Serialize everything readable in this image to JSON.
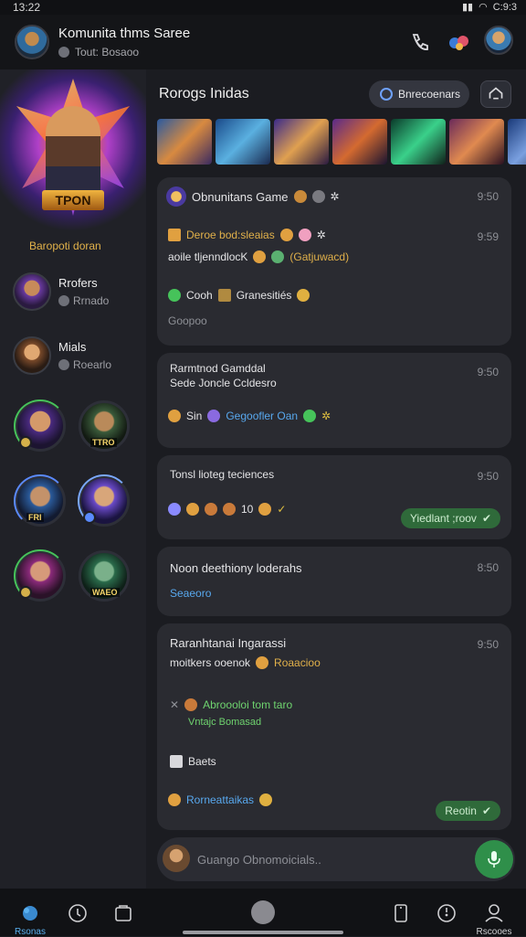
{
  "status": {
    "time": "13:22",
    "battery": "C:9:3"
  },
  "header": {
    "title": "Komunita thms Saree",
    "subtitle": "Tout: Bosaoo"
  },
  "sidebar": {
    "hero_badge": "TPON",
    "hero_caption": "Baropoti doran",
    "items": [
      {
        "name": "Rrofers",
        "meta": "Rrnado"
      },
      {
        "name": "Mials",
        "meta": "Roearlo"
      }
    ],
    "avatar_tags": [
      "TTRO",
      "FRI",
      "WAEO"
    ]
  },
  "main": {
    "section_title": "Rorogs Inidas",
    "browse_label": "Bnrecoenars"
  },
  "cards": [
    {
      "title": "Obnunitans Game",
      "time": "9:50",
      "line2": "Deroe bod:sleaias",
      "line2_time": "9:59",
      "line3a": "aoile tljenndlocK",
      "line3b": "(Gatjuwacd)",
      "line4a": "Cooh",
      "line4b": "Granesitiés",
      "footer": "Goopoo"
    },
    {
      "title": "Rarmtnod Gamddal",
      "time": "9:50",
      "line2": "Sede Joncle Ccldesro",
      "line3a": "Sin",
      "line3b": "Gegoofler Oan"
    },
    {
      "title": "Tonsl lioteg teciences",
      "time": "9:50",
      "line2": "10",
      "pill": "Yiedlant ;roov"
    },
    {
      "title": "Noon deethiony loderahs",
      "time": "8:50",
      "line2": "Seaeoro"
    },
    {
      "title": "Raranhtanai Ingarassi",
      "time": "9:50",
      "line2a": "moitkers ooenok",
      "line2b": "Roaacioo",
      "line3": "Abroooloi tom taro",
      "line4": "Vntajc Bomasad",
      "line5": "Baets",
      "line6": "Rorneattaikas",
      "pill": "Reotin"
    }
  ],
  "composer": {
    "placeholder": "Guango Obnomoicials.."
  },
  "tabbar": {
    "home_label": "Rsonas",
    "profile_label": "Rscooes"
  },
  "colors": {
    "accent": "#2f8f4a",
    "background": "#1b1c21",
    "card": "#2a2b31",
    "gold": "#e0b04a"
  }
}
